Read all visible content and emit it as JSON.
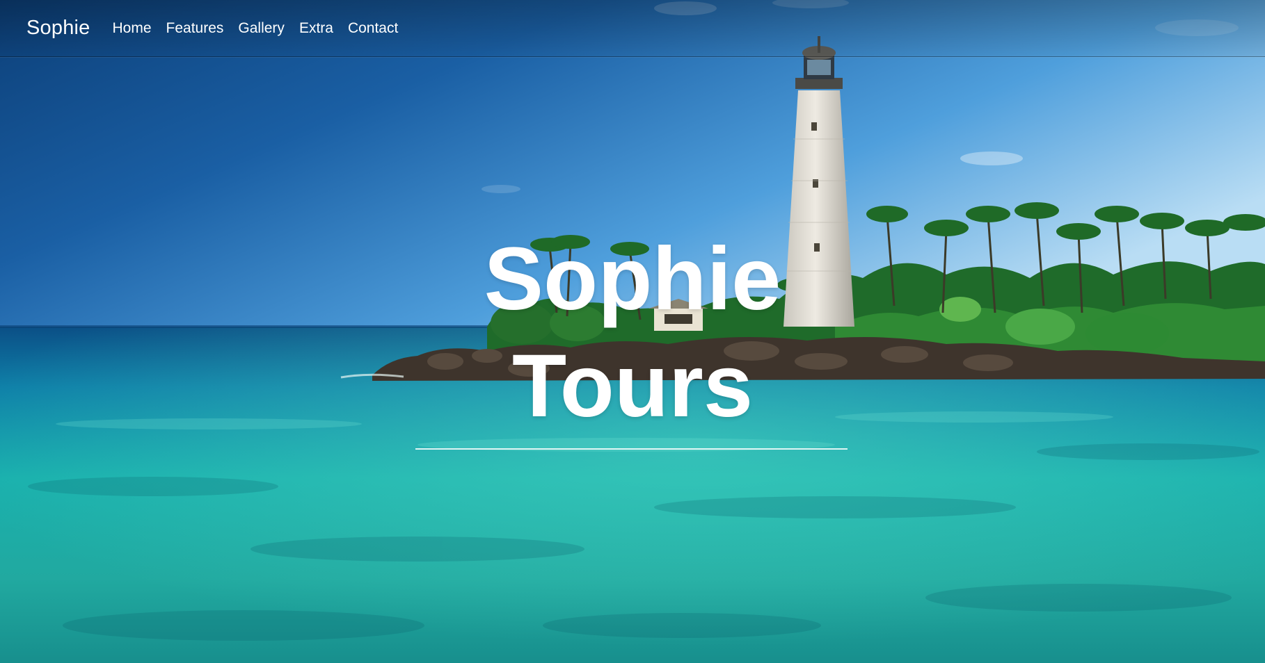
{
  "navbar": {
    "brand": "Sophie",
    "links": [
      "Home",
      "Features",
      "Gallery",
      "Extra",
      "Contact"
    ]
  },
  "hero": {
    "title_line1": "Sophie",
    "title_line2": "Tours"
  },
  "colors": {
    "sky_top": "#0f4d8a",
    "sky_light": "#7fc1ee",
    "sea_deep": "#0a5c8a",
    "sea_turquoise": "#1fb7a6",
    "text": "#ffffff"
  },
  "icons": {
    "background": "lighthouse-island-photo"
  }
}
